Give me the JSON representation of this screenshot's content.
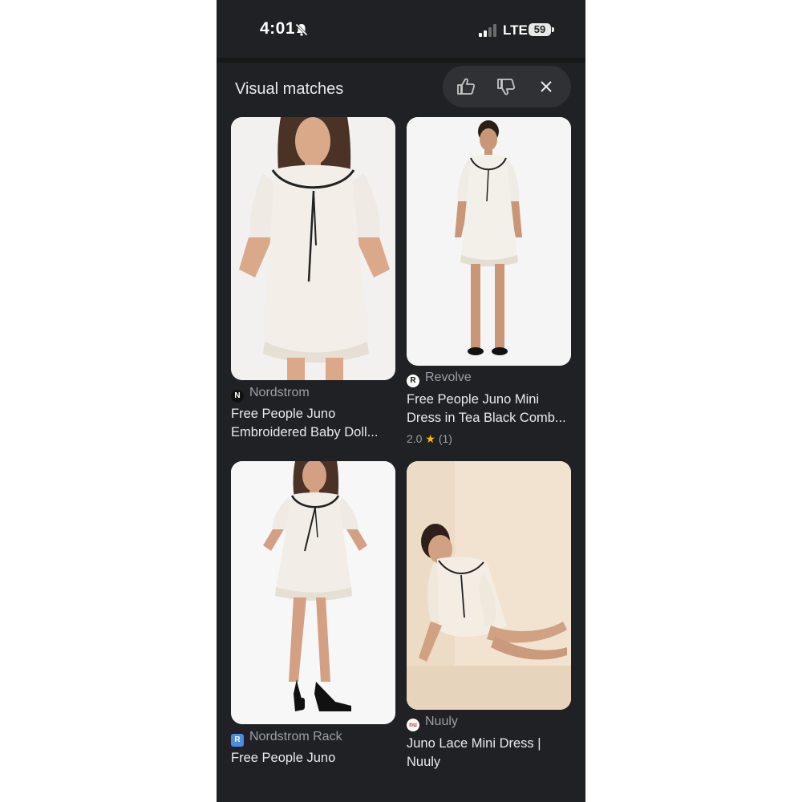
{
  "status_bar": {
    "time": "4:01",
    "network": "LTE",
    "battery": "59"
  },
  "section": {
    "title": "Visual matches"
  },
  "feedback": {
    "icons": [
      "thumbs-up-icon",
      "thumbs-down-icon",
      "close-icon"
    ]
  },
  "results": [
    {
      "source": "Nordstrom",
      "source_logo": "N",
      "title_line1": "Free People Juno",
      "title_line2": "Embroidered Baby Doll..."
    },
    {
      "source": "Revolve",
      "source_logo": "R",
      "title_line1": "Free People Juno Mini",
      "title_line2": "Dress in Tea Black Comb...",
      "rating": "2.0",
      "star": "★",
      "review_count": "(1)"
    },
    {
      "source": "Nordstrom Rack",
      "source_logo": "R",
      "title_line1": "Free People Juno"
    },
    {
      "source": "Nuuly",
      "source_logo": "nu",
      "title_line1": "Juno Lace Mini Dress |",
      "title_line2": "Nuuly"
    }
  ],
  "colors": {
    "background": "#202124",
    "text_primary": "#e8eaed",
    "text_secondary": "#9aa0a6",
    "star": "#fbbc04"
  }
}
